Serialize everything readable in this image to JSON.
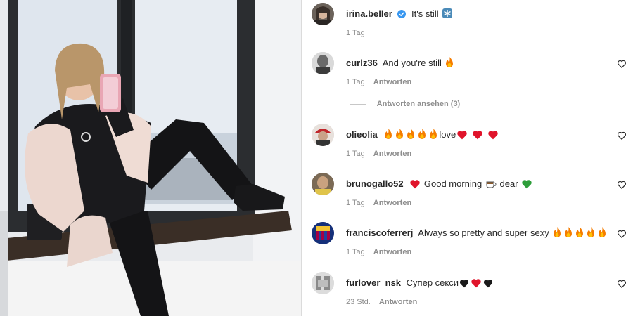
{
  "comments": [
    {
      "username": "irina.beller",
      "text": "It's still",
      "time": "1 Tag",
      "reply_label": "",
      "verified": true
    },
    {
      "username": "curlz36",
      "text": "And you're still",
      "time": "1 Tag",
      "reply_label": "Antworten"
    },
    {
      "username": "olieolia",
      "text": "love",
      "time": "1 Tag",
      "reply_label": "Antworten"
    },
    {
      "username": "brunogallo52",
      "text_a": "Good morning",
      "text_b": "dear",
      "time": "1 Tag",
      "reply_label": "Antworten"
    },
    {
      "username": "franciscoferrerj",
      "text": "Always so pretty and super sexy",
      "time": "1 Tag",
      "reply_label": "Antworten"
    },
    {
      "username": "furlover_nsk",
      "text": "Супер секси",
      "time": "23 Std.",
      "reply_label": "Antworten"
    }
  ],
  "view_replies": "Antworten ansehen (3)",
  "colors": {
    "text": "#262626",
    "secondary": "#8e8e8e",
    "verified": "#3897f0",
    "flame": "#f57c00",
    "heart_red": "#e0142b",
    "heart_green": "#2e9e3a"
  },
  "icons": [
    "verified-badge-icon",
    "snowflake-emoji",
    "flame-emoji",
    "red-heart-emoji",
    "green-heart-emoji",
    "coffee-emoji",
    "black-heart-emoji",
    "heart-outline-icon"
  ]
}
